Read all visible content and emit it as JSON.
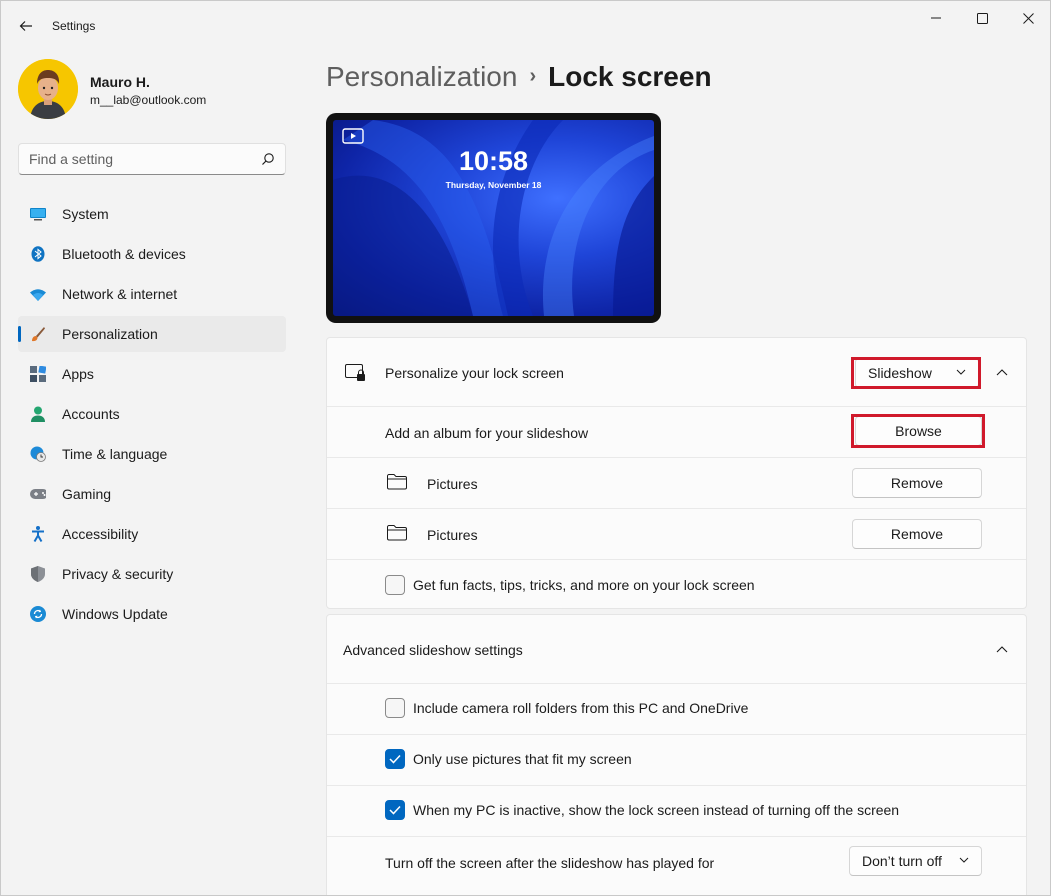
{
  "window": {
    "title": "Settings"
  },
  "profile": {
    "name": "Mauro H.",
    "email": "m__lab@outlook.com"
  },
  "search": {
    "placeholder": "Find a setting"
  },
  "sidebar": {
    "items": [
      {
        "label": "System",
        "icon": "monitor-icon"
      },
      {
        "label": "Bluetooth & devices",
        "icon": "bluetooth-icon"
      },
      {
        "label": "Network & internet",
        "icon": "wifi-icon"
      },
      {
        "label": "Personalization",
        "icon": "brush-icon",
        "active": true
      },
      {
        "label": "Apps",
        "icon": "apps-icon"
      },
      {
        "label": "Accounts",
        "icon": "person-icon"
      },
      {
        "label": "Time & language",
        "icon": "globe-clock-icon"
      },
      {
        "label": "Gaming",
        "icon": "gamepad-icon"
      },
      {
        "label": "Accessibility",
        "icon": "accessibility-icon"
      },
      {
        "label": "Privacy & security",
        "icon": "shield-icon"
      },
      {
        "label": "Windows Update",
        "icon": "update-icon"
      }
    ]
  },
  "breadcrumb": {
    "parent": "Personalization",
    "separator": "›",
    "current": "Lock screen"
  },
  "preview": {
    "time": "10:58",
    "date": "Thursday, November 18"
  },
  "lock_card": {
    "personalize_label": "Personalize your lock screen",
    "personalize_value": "Slideshow",
    "album_label": "Add an album for your slideshow",
    "browse_label": "Browse",
    "folders": [
      {
        "name": "Pictures",
        "remove_label": "Remove"
      },
      {
        "name": "Pictures",
        "remove_label": "Remove"
      }
    ],
    "fun_facts_label": "Get fun facts, tips, tricks, and more on your lock screen",
    "fun_facts_checked": false
  },
  "advanced": {
    "header": "Advanced slideshow settings",
    "options": [
      {
        "label": "Include camera roll folders from this PC and OneDrive",
        "checked": false
      },
      {
        "label": "Only use pictures that fit my screen",
        "checked": true
      },
      {
        "label": "When my PC is inactive, show the lock screen instead of turning off the screen",
        "checked": true
      }
    ],
    "turn_off_label": "Turn off the screen after the slideshow has played for",
    "turn_off_value": "Don’t turn off"
  },
  "colors": {
    "accent": "#0067c0",
    "highlight": "#d0192b",
    "avatar": "#f6c600"
  }
}
